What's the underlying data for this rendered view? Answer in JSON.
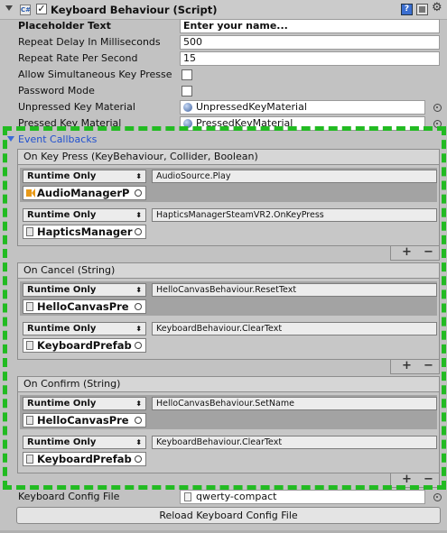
{
  "component": {
    "title": "Keyboard Behaviour (Script)",
    "enabled": true,
    "help_icon": "help-icon",
    "preset_icon": "preset-icon",
    "gear_icon": "gear-icon"
  },
  "properties": [
    {
      "label": "Placeholder Text",
      "value": "Enter your name...",
      "bold": true
    },
    {
      "label": "Repeat Delay In Milliseconds",
      "value": "500"
    },
    {
      "label": "Repeat Rate Per Second",
      "value": "15"
    },
    {
      "label": "Allow Simultaneous Key Presse",
      "checked": false
    },
    {
      "label": "Password Mode",
      "checked": false
    },
    {
      "label": "Unpressed Key Material",
      "value": "UnpressedKeyMaterial"
    },
    {
      "label": "Pressed Key Material",
      "value": "PressedKeyMaterial"
    }
  ],
  "event_callbacks": {
    "label": "Event Callbacks",
    "plus": "+",
    "minus": "−",
    "events": [
      {
        "header": "On Key Press (KeyBehaviour, Collider, Boolean)",
        "listeners": [
          {
            "mode": "Runtime Only",
            "function": "AudioSource.Play",
            "object": "AudioManagerP",
            "icon": "audio-source-icon"
          },
          {
            "mode": "Runtime Only",
            "function": "HapticsManagerSteamVR2.OnKeyPress",
            "object": "HapticsManager",
            "icon": "gameobject-icon"
          }
        ]
      },
      {
        "header": "On Cancel (String)",
        "listeners": [
          {
            "mode": "Runtime Only",
            "function": "HelloCanvasBehaviour.ResetText",
            "object": "HelloCanvasPre",
            "icon": "gameobject-icon"
          },
          {
            "mode": "Runtime Only",
            "function": "KeyboardBehaviour.ClearText",
            "object": "KeyboardPrefab",
            "icon": "gameobject-icon"
          }
        ]
      },
      {
        "header": "On Confirm (String)",
        "listeners": [
          {
            "mode": "Runtime Only",
            "function": "HelloCanvasBehaviour.SetName",
            "object": "HelloCanvasPre",
            "icon": "gameobject-icon"
          },
          {
            "mode": "Runtime Only",
            "function": "KeyboardBehaviour.ClearText",
            "object": "KeyboardPrefab",
            "icon": "gameobject-icon"
          }
        ]
      }
    ]
  },
  "config": {
    "label": "Keyboard Config File",
    "value": "qwerty-compact",
    "reload_button": "Reload Keyboard Config File"
  },
  "colors": {
    "highlight_dash": "#22bb22",
    "link_blue": "#2050d0"
  }
}
